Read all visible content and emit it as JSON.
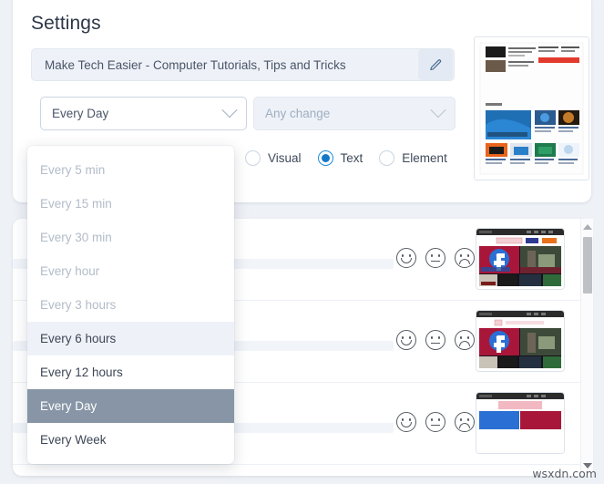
{
  "page": {
    "title": "Settings",
    "watermark": "wsxdn.com",
    "background_color": "#eef1f6"
  },
  "settings": {
    "monitor_title": {
      "value": "Make Tech Easier - Computer Tutorials, Tips and Tricks",
      "edit_icon": "pencil-icon"
    },
    "interval_select": {
      "value": "Every Day",
      "chevron": "chevron-down-icon",
      "expanded": true,
      "options": [
        {
          "label": "Every 5 min",
          "state": "disabled"
        },
        {
          "label": "Every 15 min",
          "state": "disabled"
        },
        {
          "label": "Every 30 min",
          "state": "disabled"
        },
        {
          "label": "Every hour",
          "state": "disabled"
        },
        {
          "label": "Every 3 hours",
          "state": "disabled"
        },
        {
          "label": "Every 6 hours",
          "state": "hover"
        },
        {
          "label": "Every 12 hours",
          "state": "normal"
        },
        {
          "label": "Every Day",
          "state": "selected"
        },
        {
          "label": "Every Week",
          "state": "normal"
        }
      ]
    },
    "change_select": {
      "value": "Any change",
      "chevron": "chevron-down-icon",
      "disabled": true
    },
    "mode_radios": {
      "selected": "Text",
      "accent_color": "#1478c8",
      "items": [
        {
          "label": "Visual",
          "checked": false
        },
        {
          "label": "Text",
          "checked": true
        },
        {
          "label": "Element",
          "checked": false
        }
      ]
    }
  },
  "list": {
    "rows": [
      {
        "reactions": [
          "happy-face",
          "neutral-face",
          "sad-face"
        ]
      },
      {
        "reactions": [
          "happy-face",
          "neutral-face",
          "sad-face"
        ]
      },
      {
        "reactions": [
          "happy-face",
          "neutral-face",
          "sad-face"
        ]
      }
    ],
    "scrollbar": {
      "up_arrow": "scroll-up-arrow",
      "down_arrow": "scroll-down-arrow"
    }
  }
}
